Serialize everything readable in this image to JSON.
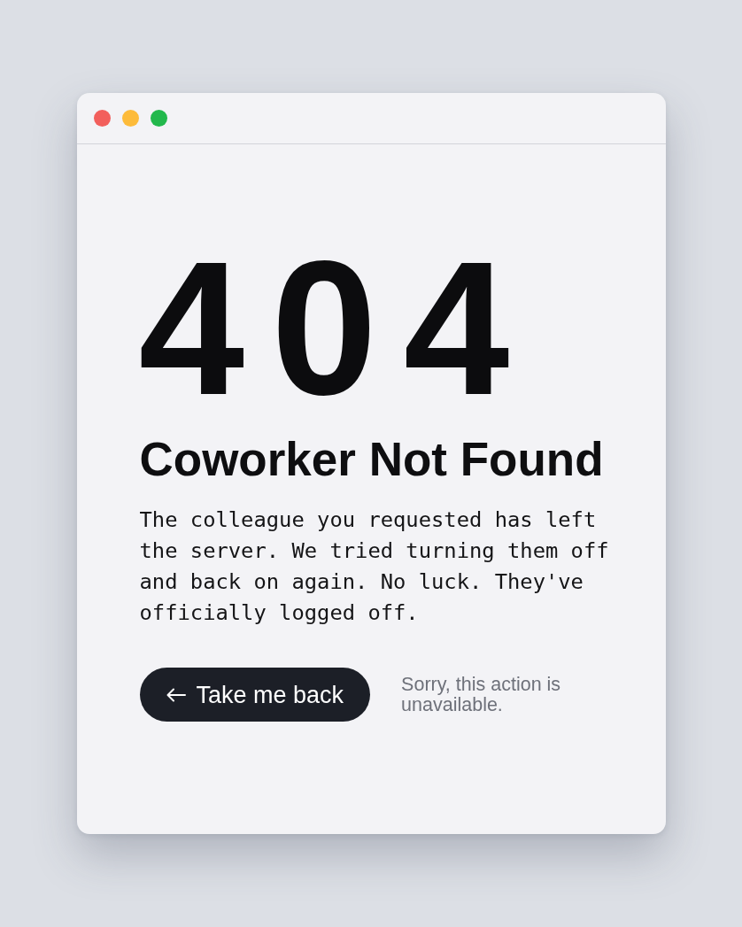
{
  "window": {
    "controls": [
      {
        "color": "#f25f5c"
      },
      {
        "color": "#fdbb3a"
      },
      {
        "color": "#22b84c"
      }
    ]
  },
  "error": {
    "code": "404",
    "title": "Coworker Not Found",
    "message": "The colleague you requested has left the server. We tried turning them off and back on again. No luck. They've officially logged off.",
    "button": {
      "label": "Take me back"
    },
    "note": "Sorry, this action is unavailable."
  }
}
